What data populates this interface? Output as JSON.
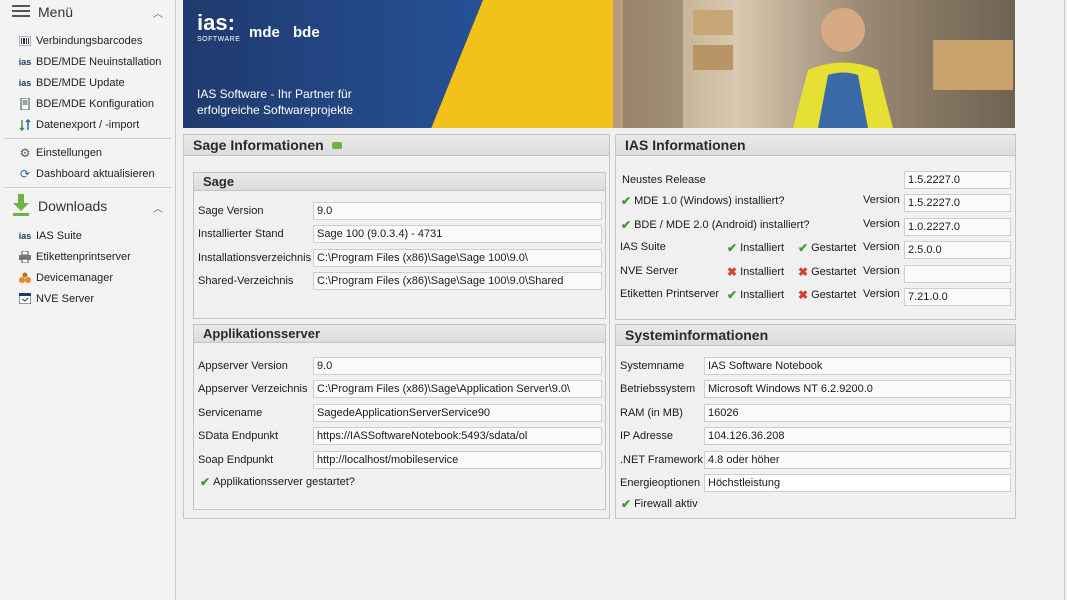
{
  "sidebar": {
    "menu_title": "Menü",
    "menu_items": [
      {
        "label": "Verbindungsbarcodes",
        "icon": "barcode-icon"
      },
      {
        "label": "BDE/MDE Neuinstallation",
        "icon": "ias-icon"
      },
      {
        "label": "BDE/MDE Update",
        "icon": "ias-icon"
      },
      {
        "label": "BDE/MDE Konfiguration",
        "icon": "device-icon"
      },
      {
        "label": "Datenexport / -import",
        "icon": "transfer-icon"
      },
      {
        "label": "Einstellungen",
        "icon": "gear-icon"
      },
      {
        "label": "Dashboard aktualisieren",
        "icon": "refresh-icon"
      }
    ],
    "downloads_title": "Downloads",
    "download_items": [
      {
        "label": "IAS Suite",
        "icon": "ias-icon"
      },
      {
        "label": "Etikettenprintserver",
        "icon": "printer-icon"
      },
      {
        "label": "Devicemanager",
        "icon": "device-manager-icon"
      },
      {
        "label": "NVE Server",
        "icon": "server-icon"
      }
    ]
  },
  "banner": {
    "logo": "ias:",
    "logo_sub": "SOFTWARE",
    "mde": "mde",
    "bde": "bde",
    "tagline_1": "IAS Software - Ihr Partner für",
    "tagline_2": "erfolgreiche Softwareprojekte"
  },
  "sage": {
    "title": "Sage Informationen",
    "sub_title": "Sage",
    "rows": [
      {
        "label": "Sage Version",
        "value": "9.0"
      },
      {
        "label": "Installierter Stand",
        "value": "Sage 100 (9.0.3.4) - 4731"
      },
      {
        "label": "Installationsverzeichnis",
        "value": "C:\\Program Files (x86)\\Sage\\Sage 100\\9.0\\"
      },
      {
        "label": "Shared-Verzeichnis",
        "value": "C:\\Program Files (x86)\\Sage\\Sage 100\\9.0\\Shared"
      }
    ]
  },
  "appserver": {
    "title": "Applikationsserver",
    "rows": [
      {
        "label": "Appserver Version",
        "value": "9.0"
      },
      {
        "label": "Appserver Verzeichnis",
        "value": "C:\\Program Files (x86)\\Sage\\Application Server\\9.0\\"
      },
      {
        "label": "Servicename",
        "value": "SagedeApplicationServerService90"
      },
      {
        "label": "SData Endpunkt",
        "value": "https://IASSoftwareNotebook:5493/sdata/ol"
      },
      {
        "label": "Soap Endpunkt",
        "value": "http://localhost/mobileservice"
      }
    ],
    "started_label": "Applikationsserver gestartet?"
  },
  "ias": {
    "title": "IAS Informationen",
    "release_label": "Neustes Release",
    "release_value": "1.5.2227.0",
    "version_label": "Version",
    "installed_label": "Installiert",
    "started_label": "Gestartet",
    "mde_label": "MDE 1.0 (Windows) installiert?",
    "mde_version": "1.5.2227.0",
    "bde_label": "BDE / MDE 2.0 (Android) installiert?",
    "bde_version": "1.0.2227.0",
    "suite_label": "IAS Suite",
    "suite_version": "2.5.0.0",
    "nve_label": "NVE Server",
    "nve_version": "",
    "etikett_label": "Etiketten Printserver",
    "etikett_version": "7.21.0.0"
  },
  "system": {
    "title": "Systeminformationen",
    "rows": [
      {
        "label": "Systemname",
        "value": "IAS Software Notebook"
      },
      {
        "label": "Betriebssystem",
        "value": "Microsoft Windows NT 6.2.9200.0"
      },
      {
        "label": "RAM (in MB)",
        "value": "16026"
      },
      {
        "label": "IP Adresse",
        "value": "104.126.36.208"
      },
      {
        "label": ".NET Framework",
        "value": "4.8 oder höher"
      },
      {
        "label": "Energieoptionen",
        "value": "Höchstleistung"
      }
    ],
    "firewall_label": "Firewall aktiv"
  },
  "colors": {
    "check": "#3e9a2c",
    "cross": "#d1432a",
    "banner_yellow": "#f2c21b",
    "banner_blue": "#27539a"
  }
}
